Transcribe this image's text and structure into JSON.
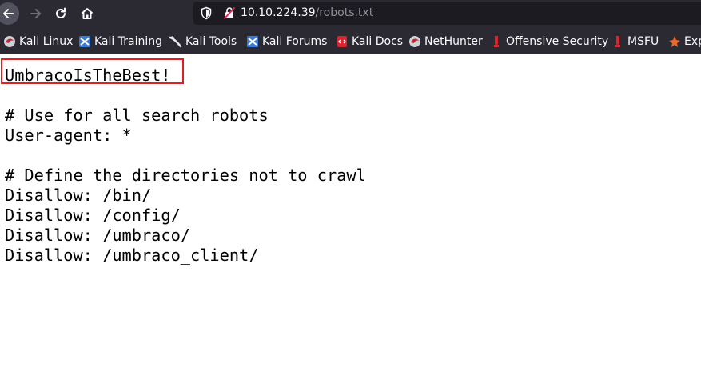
{
  "browser": {
    "url_host": "10.10.224.39",
    "url_path": "/robots.txt",
    "nav_icons": [
      "back-arrow-icon",
      "forward-arrow-icon",
      "reload-icon",
      "home-icon"
    ]
  },
  "bookmarks": [
    {
      "label": "Kali Linux",
      "icon": "kali-linux-icon"
    },
    {
      "label": "Kali Training",
      "icon": "kali-training-icon"
    },
    {
      "label": "Kali Tools",
      "icon": "kali-tools-icon"
    },
    {
      "label": "Kali Forums",
      "icon": "kali-forums-icon"
    },
    {
      "label": "Kali Docs",
      "icon": "kali-docs-icon"
    },
    {
      "label": "NetHunter",
      "icon": "nethunter-icon"
    },
    {
      "label": "Offensive Security",
      "icon": "offensive-security-icon"
    },
    {
      "label": "MSFU",
      "icon": "msfu-icon"
    },
    {
      "label": "Exp",
      "icon": "exploit-db-icon"
    }
  ],
  "document": {
    "lines": [
      "UmbracoIsTheBest!",
      "",
      "# Use for all search robots",
      "User-agent: *",
      "",
      "# Define the directories not to crawl",
      "Disallow: /bin/",
      "Disallow: /config/",
      "Disallow: /umbraco/",
      "Disallow: /umbraco_client/"
    ]
  },
  "colors": {
    "browser_chrome": "#2b2a33",
    "url_field": "#1c1b22",
    "highlight_border": "#e02020"
  }
}
